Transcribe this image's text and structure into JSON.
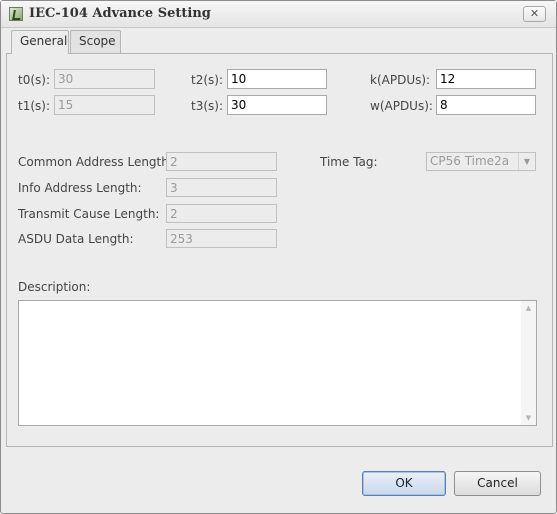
{
  "window": {
    "title": "IEC-104 Advance Setting",
    "close_glyph": "✕"
  },
  "tabs": [
    {
      "label": "General",
      "active": true
    },
    {
      "label": "Scope",
      "active": false
    }
  ],
  "timing": {
    "t0": {
      "label": "t0(s):",
      "value": "30",
      "enabled": false
    },
    "t1": {
      "label": "t1(s):",
      "value": "15",
      "enabled": false
    },
    "t2": {
      "label": "t2(s):",
      "value": "10",
      "enabled": true
    },
    "t3": {
      "label": "t3(s):",
      "value": "30",
      "enabled": true
    },
    "k": {
      "label": "k(APDUs):",
      "value": "12",
      "enabled": true
    },
    "w": {
      "label": "w(APDUs):",
      "value": "8",
      "enabled": true
    }
  },
  "lengths": {
    "common_address": {
      "label": "Common Address Length:",
      "value": "2"
    },
    "info_address": {
      "label": "Info Address Length:",
      "value": "3"
    },
    "transmit_cause": {
      "label": "Transmit Cause Length:",
      "value": "2"
    },
    "asdu_data": {
      "label": "ASDU Data Length:",
      "value": "253"
    }
  },
  "time_tag": {
    "label": "Time Tag:",
    "value": "CP56 Time2a"
  },
  "description": {
    "label": "Description:",
    "value": ""
  },
  "buttons": {
    "ok": "OK",
    "cancel": "Cancel"
  }
}
